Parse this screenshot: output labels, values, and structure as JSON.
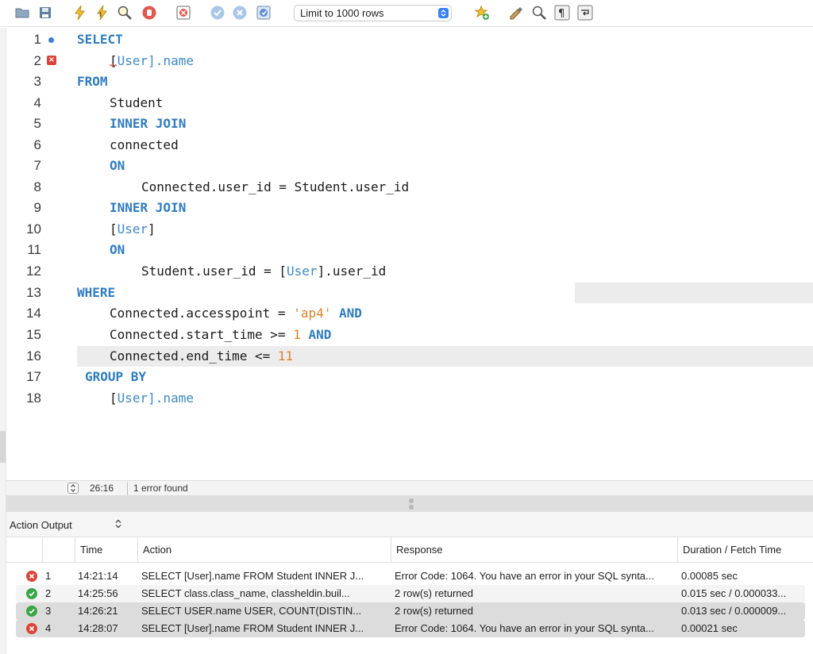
{
  "toolbar": {
    "icons": [
      "folder-icon",
      "save-icon",
      "execute-icon",
      "execute-current-icon",
      "explain-icon",
      "stop-icon",
      "toggle-continue-on-error-icon",
      "commit-icon",
      "rollback-icon",
      "autocommit-icon",
      "add-snippet-icon",
      "beautify-icon",
      "find-icon",
      "invisible-chars-icon",
      "wrap-lines-icon"
    ],
    "limit_select_value": "Limit to 1000 rows"
  },
  "editor": {
    "lines": [
      {
        "n": "1",
        "marker": "dot"
      },
      {
        "n": "2",
        "marker": "error"
      },
      {
        "n": "3"
      },
      {
        "n": "4"
      },
      {
        "n": "5"
      },
      {
        "n": "6"
      },
      {
        "n": "7"
      },
      {
        "n": "8"
      },
      {
        "n": "9"
      },
      {
        "n": "10"
      },
      {
        "n": "11"
      },
      {
        "n": "12"
      },
      {
        "n": "13"
      },
      {
        "n": "14"
      },
      {
        "n": "15"
      },
      {
        "n": "16"
      },
      {
        "n": "17"
      },
      {
        "n": "18"
      }
    ],
    "tokens": {
      "select": "SELECT",
      "l2_open": "[",
      "l2_user": "User",
      "l2_rest": "].name",
      "from": "FROM",
      "student": "Student",
      "inner_join": "INNER JOIN",
      "connected": "connected",
      "on": "ON",
      "l8": "Connected.user_id = Student.user_id",
      "l10_open": "[",
      "l10_user": "User",
      "l10_close": "]",
      "l12_a": "Student.user_id = [",
      "l12_user": "User",
      "l12_b": "].user_id",
      "where": "WHERE",
      "l14_a": "Connected.accesspoint = ",
      "l14_str": "'ap4'",
      "and": "AND",
      "l15_a": "Connected.start_time >= ",
      "l15_num": "1",
      "l16_a": "Connected.end_time <= ",
      "l16_num": "11",
      "group_by": "GROUP BY",
      "l18_open": "[",
      "l18_user": "User",
      "l18_rest": "].name"
    }
  },
  "status": {
    "cursor": "26:16",
    "message": "1 error found"
  },
  "output": {
    "panel_label": "Action Output",
    "columns": [
      "Time",
      "Action",
      "Response",
      "Duration / Fetch Time"
    ],
    "rows": [
      {
        "status": "error",
        "num": "1",
        "time": "14:21:14",
        "action": "SELECT  [User].name FROM  Student  INNER J...",
        "response": "Error Code: 1064. You have an error in your SQL synta...",
        "duration": "0.00085 sec"
      },
      {
        "status": "ok",
        "num": "2",
        "time": "14:25:56",
        "action": "SELECT    class.class_name,    classheldin.buil...",
        "response": "2 row(s) returned",
        "duration": "0.015 sec / 0.000033..."
      },
      {
        "status": "ok",
        "num": "3",
        "time": "14:26:21",
        "action": "SELECT    USER.name USER,    COUNT(DISTIN...",
        "response": "2 row(s) returned",
        "duration": "0.013 sec / 0.000009..."
      },
      {
        "status": "error",
        "num": "4",
        "time": "14:28:07",
        "action": "SELECT  [User].name FROM  Student  INNER J...",
        "response": "Error Code: 1064. You have an error in your SQL synta...",
        "duration": "0.00021 sec"
      }
    ]
  },
  "colors": {
    "keyword": "#2f7cbf",
    "string": "#d9822b",
    "error": "#d9453a",
    "success": "#3aa648"
  }
}
